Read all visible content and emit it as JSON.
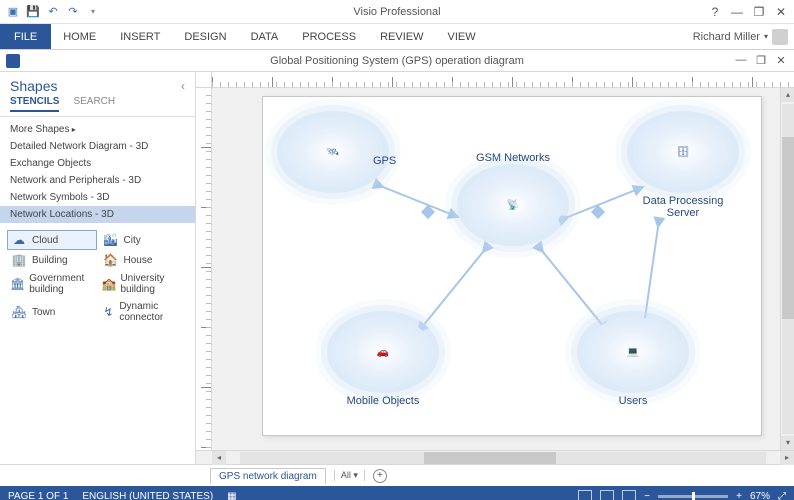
{
  "app": {
    "title": "Visio Professional",
    "user": "Richard Miller"
  },
  "qat": [
    "save",
    "undo",
    "redo"
  ],
  "windowControls": {
    "help": "?",
    "min": "—",
    "max": "❐",
    "close": "✕"
  },
  "ribbon": {
    "file": "FILE",
    "tabs": [
      "HOME",
      "INSERT",
      "DESIGN",
      "DATA",
      "PROCESS",
      "REVIEW",
      "VIEW"
    ]
  },
  "document": {
    "title": "Global Positioning System (GPS) operation diagram",
    "controls": {
      "min": "—",
      "max": "❐",
      "close": "✕"
    }
  },
  "shapes": {
    "heading": "Shapes",
    "subTabs": {
      "active": "STENCILS",
      "inactive": "SEARCH"
    },
    "collapseGlyph": "‹",
    "stencils": [
      {
        "label": "More Shapes",
        "more": true
      },
      {
        "label": "Detailed Network Diagram - 3D"
      },
      {
        "label": "Exchange Objects"
      },
      {
        "label": "Network and Peripherals - 3D"
      },
      {
        "label": "Network Symbols - 3D"
      },
      {
        "label": "Network Locations - 3D",
        "selected": true
      }
    ],
    "grid": [
      {
        "label": "Cloud",
        "icon": "☁",
        "selected": true
      },
      {
        "label": "City",
        "icon": "🏙"
      },
      {
        "label": "Building",
        "icon": "🏢"
      },
      {
        "label": "House",
        "icon": "🏠"
      },
      {
        "label": "Government building",
        "icon": "🏛"
      },
      {
        "label": "University building",
        "icon": "🏫"
      },
      {
        "label": "Town",
        "icon": "🏘"
      },
      {
        "label": "Dynamic connector",
        "icon": "↯"
      }
    ]
  },
  "diagram": {
    "nodes": {
      "gps": {
        "label": "GPS"
      },
      "gsm": {
        "label": "GSM Networks"
      },
      "server": {
        "label": "Data Processing Server"
      },
      "mobile": {
        "label": "Mobile Objects"
      },
      "users": {
        "label": "Users"
      }
    }
  },
  "pageTabs": {
    "tab": "GPS network diagram",
    "all": "All ▾",
    "plus": "+"
  },
  "status": {
    "page": "PAGE 1 OF 1",
    "lang": "ENGLISH (UNITED STATES)",
    "zoom": "67%",
    "zoomMinus": "−",
    "zoomPlus": "+",
    "fit": "⤢"
  }
}
